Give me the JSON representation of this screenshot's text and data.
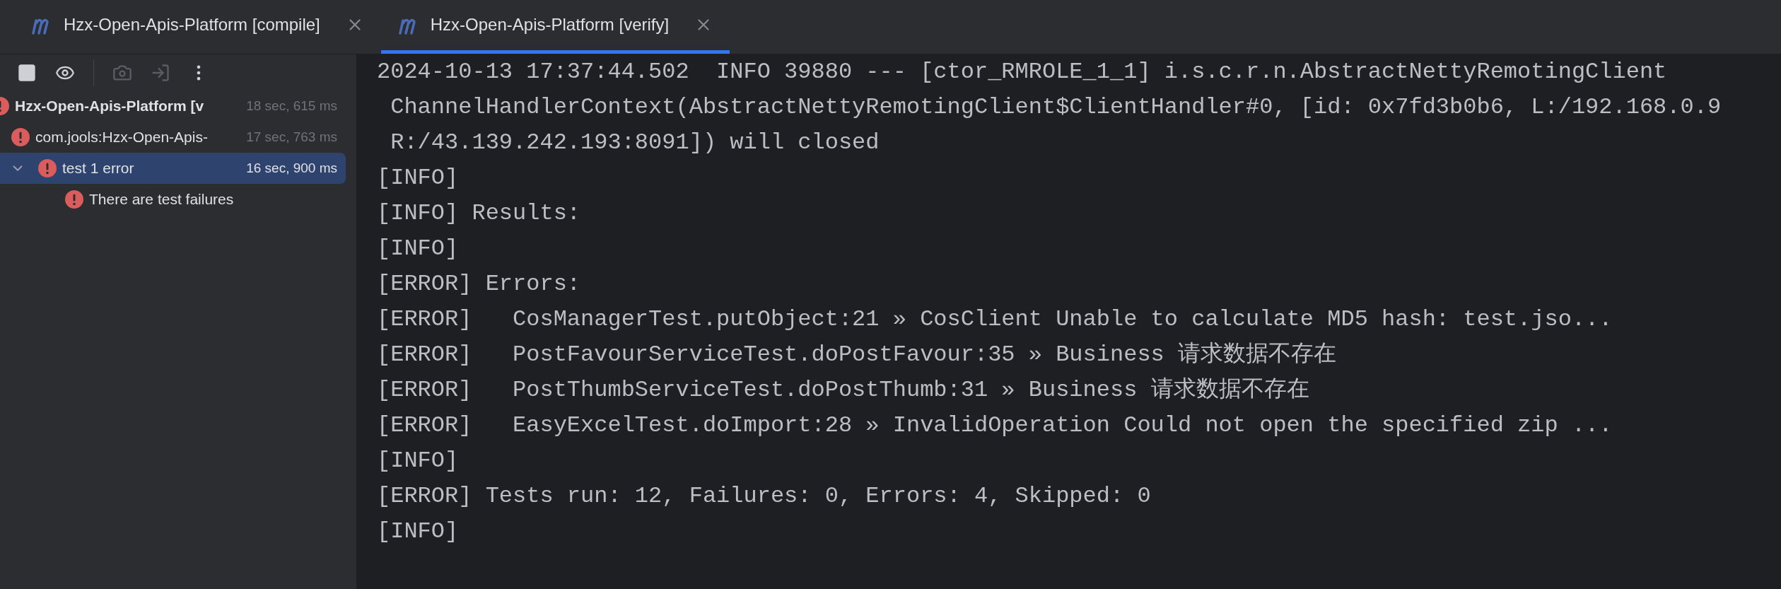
{
  "tabs": [
    {
      "label": "Hzx-Open-Apis-Platform [compile]",
      "selected": false
    },
    {
      "label": "Hzx-Open-Apis-Platform [verify]",
      "selected": true
    }
  ],
  "toolbar": [
    {
      "kind": "stop",
      "disabled": false
    },
    {
      "kind": "eye",
      "disabled": false
    },
    {
      "kind": "camera",
      "disabled": true
    },
    {
      "kind": "import",
      "disabled": true
    },
    {
      "kind": "more",
      "disabled": false
    }
  ],
  "tree": [
    {
      "label": "Hzx-Open-Apis-Platform [v",
      "time": "18 sec, 615 ms",
      "kind": "error",
      "selected": false,
      "children": [
        {
          "label": "com.jools:Hzx-Open-Apis-",
          "time": "17 sec, 763 ms",
          "kind": "error",
          "selected": false,
          "children": [
            {
              "label": "test  1 error",
              "time": "16 sec, 900 ms",
              "kind": "error",
              "selected": true,
              "expanded": true,
              "children": [
                {
                  "label": "There are test failures",
                  "kind": "error",
                  "selected": false
                }
              ]
            }
          ]
        }
      ]
    }
  ],
  "console": [
    "2024-10-13 17:37:44.502  INFO 39880 --- [ctor_RMROLE_1_1] i.s.c.r.n.AbstractNettyRemotingClient",
    " ChannelHandlerContext(AbstractNettyRemotingClient$ClientHandler#0, [id: 0x7fd3b0b6, L:/192.168.0.9",
    " R:/43.139.242.193:8091]) will closed",
    "[INFO]",
    "[INFO] Results:",
    "[INFO]",
    "[ERROR] Errors:",
    "[ERROR]   CosManagerTest.putObject:21 » CosClient Unable to calculate MD5 hash: test.jso...",
    "[ERROR]   PostFavourServiceTest.doPostFavour:35 » Business 请求数据不存在",
    "[ERROR]   PostThumbServiceTest.doPostThumb:31 » Business 请求数据不存在",
    "[ERROR]   EasyExcelTest.doImport:28 » InvalidOperation Could not open the specified zip ...",
    "[INFO]",
    "[ERROR] Tests run: 12, Failures: 0, Errors: 4, Skipped: 0",
    "[INFO]"
  ]
}
